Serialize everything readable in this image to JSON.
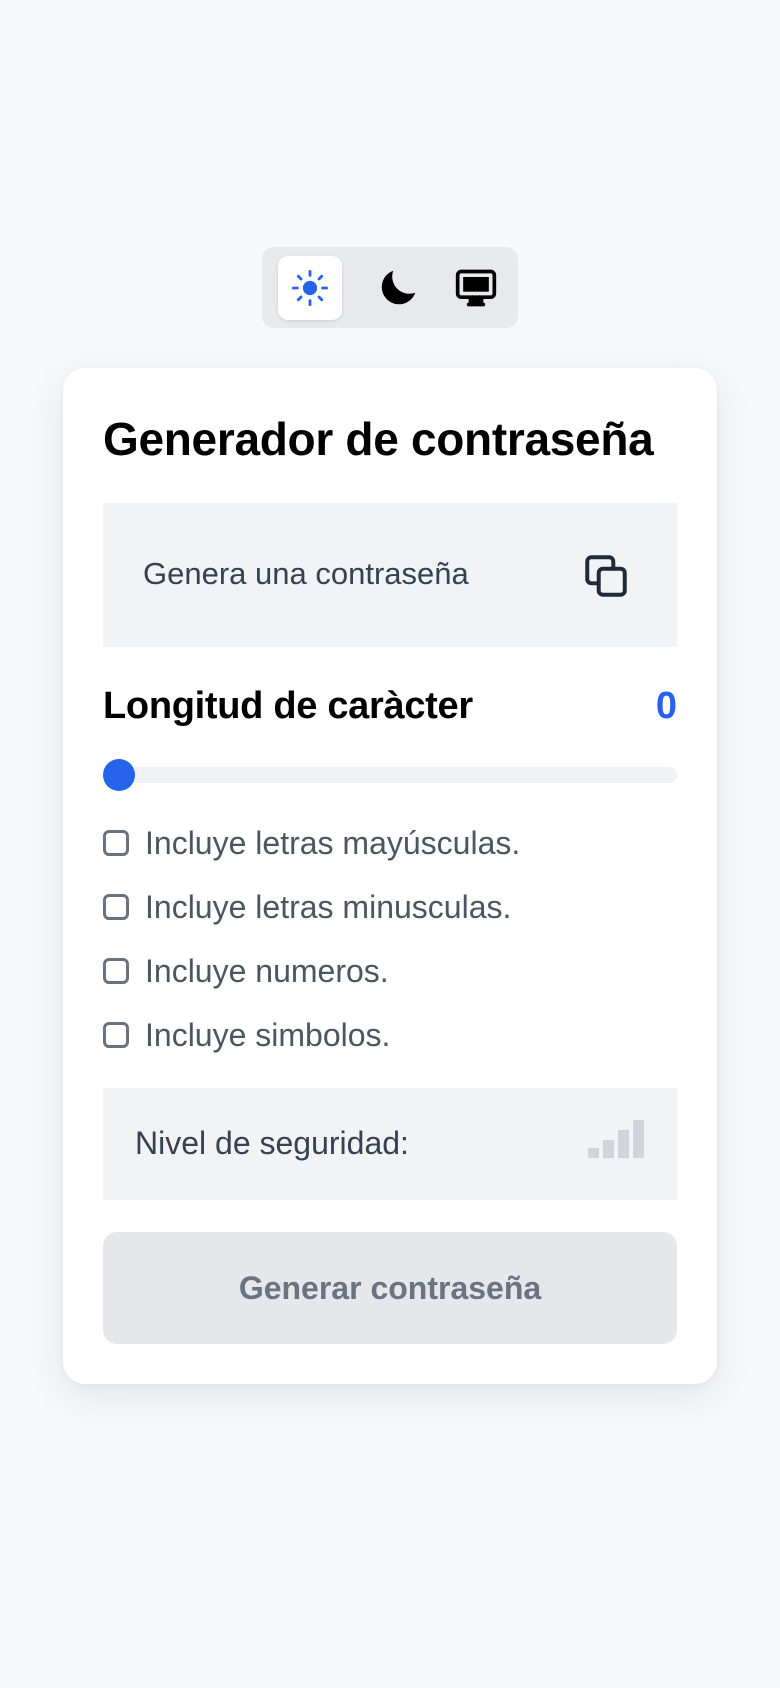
{
  "theme_switcher": {
    "options": [
      {
        "name": "light",
        "icon": "sun-icon",
        "active": true
      },
      {
        "name": "dark",
        "icon": "moon-icon",
        "active": false
      },
      {
        "name": "system",
        "icon": "monitor-icon",
        "active": false
      }
    ],
    "active_color": "#2563eb"
  },
  "card": {
    "title": "Generador de contraseña",
    "output": {
      "placeholder": "Genera una contraseña",
      "copy_icon": "copy-icon"
    },
    "length": {
      "label": "Longitud de caràcter",
      "value": "0",
      "slider_value": 0,
      "accent_color": "#2563eb"
    },
    "options": [
      {
        "label": "Incluye letras mayúsculas.",
        "checked": false
      },
      {
        "label": "Incluye letras minusculas.",
        "checked": false
      },
      {
        "label": "Incluye numeros.",
        "checked": false
      },
      {
        "label": "Incluye simbolos.",
        "checked": false
      }
    ],
    "security": {
      "label": "Nivel de seguridad:",
      "icon": "signal-bars-icon",
      "level": 0
    },
    "generate_button": "Generar contraseña"
  }
}
